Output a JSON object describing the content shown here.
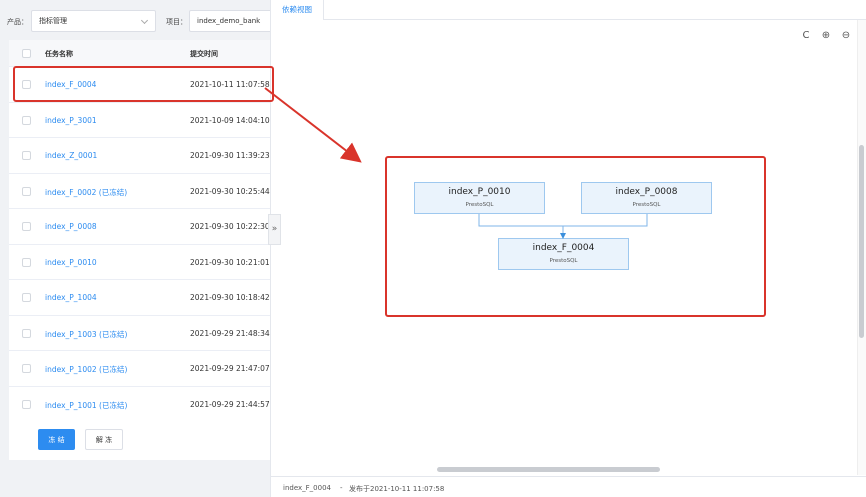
{
  "filter": {
    "product_label": "产品：",
    "product_value": "指标管理",
    "project_label": "项目：",
    "project_value": "index_demo_bank"
  },
  "table": {
    "columns": [
      "任务名称",
      "提交时间"
    ],
    "rows": [
      {
        "name": "index_F_0004",
        "time": "2021-10-11 11:07:58"
      },
      {
        "name": "index_P_3001",
        "time": "2021-10-09 14:04:10"
      },
      {
        "name": "index_Z_0001",
        "time": "2021-09-30 11:39:23"
      },
      {
        "name": "index_F_0002 (已冻结)",
        "time": "2021-09-30 10:25:44"
      },
      {
        "name": "index_P_0008",
        "time": "2021-09-30 10:22:30"
      },
      {
        "name": "index_P_0010",
        "time": "2021-09-30 10:21:01"
      },
      {
        "name": "index_P_1004",
        "time": "2021-09-30 10:18:42"
      },
      {
        "name": "index_P_1003 (已冻结)",
        "time": "2021-09-29 21:48:34"
      },
      {
        "name": "index_P_1002 (已冻结)",
        "time": "2021-09-29 21:47:07"
      },
      {
        "name": "index_P_1001 (已冻结)",
        "time": "2021-09-29 21:44:57"
      }
    ],
    "freeze_label": "冻 结",
    "unfreeze_label": "解 冻"
  },
  "panel": {
    "tab_label": "依赖视图",
    "toggle_glyph": "»",
    "refresh_glyph": "C",
    "zoom_in_glyph": "⊕",
    "zoom_out_glyph": "⊖"
  },
  "graph": {
    "nodes": [
      {
        "id": "p0010",
        "title": "index_P_0010",
        "type": "PrestoSQL"
      },
      {
        "id": "p0008",
        "title": "index_P_0008",
        "type": "PrestoSQL"
      },
      {
        "id": "f0004",
        "title": "index_F_0004",
        "type": "PrestoSQL"
      }
    ]
  },
  "status": {
    "task": "index_F_0004",
    "sep": "-",
    "published": "发布于2021-10-11 11:07:58"
  },
  "colors": {
    "accent": "#2d8cf0",
    "highlight": "#d9342b",
    "node_fill": "#eaf3fc",
    "node_border": "#9ec8ef"
  }
}
